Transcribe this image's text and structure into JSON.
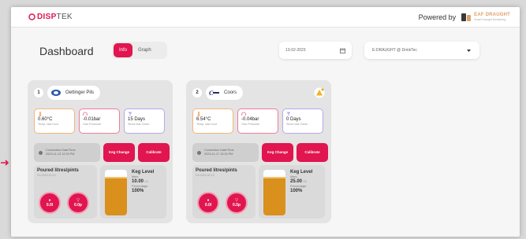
{
  "app": {
    "logo_main": "DISP",
    "logo_rest": "TEK",
    "powered_by": "Powered by",
    "brand_name_1": "EAF DRAUGHT",
    "brand_sub": "Smart Draught Monitoring"
  },
  "dashboard": {
    "title": "Dashboard",
    "tab_info": "Info",
    "tab_graph": "Graph",
    "date": "13-02-2023",
    "selector": "E-DRAUGHT @ DrinkTec"
  },
  "cards": [
    {
      "index": "1",
      "product": "Oettinger Pils",
      "temp_value": "0.60°C",
      "temp_label": "Temp. last hour",
      "pressure_value": "-0.01bar",
      "pressure_label": "Gas Pressure",
      "days_value": "15 Days",
      "days_label": "Since last Clean",
      "conn_label": "Connection Date/Time",
      "conn_value": "2023-11-13 12:00 PM",
      "keg_change": "Keg Change",
      "calibrate": "Calibrate",
      "poured_title": "Poured litres/pints",
      "poured_sub": "On 2023-02-13",
      "litres": "0.0l",
      "pints": "0.0p",
      "keg_level_title": "Keg Level",
      "keg_litres_label": "litres",
      "keg_litres_value": "10.00",
      "keg_litres_unit": "/10",
      "keg_pct_label": "Percentage",
      "keg_pct_value": "100%",
      "keg_fill": 0.85
    },
    {
      "index": "2",
      "product": "Coors",
      "temp_value": "6.54°C",
      "temp_label": "Temp. last hour",
      "pressure_value": "-0.04bar",
      "pressure_label": "Gas Pressure",
      "days_value": "0 Days",
      "days_label": "Since last Clean",
      "conn_label": "Connection Date/Time",
      "conn_value": "2023-11-17 12:00 PM",
      "keg_change": "Keg Change",
      "calibrate": "Calibrate",
      "poured_title": "Poured litres/pints",
      "poured_sub": "On 2023-02-13",
      "litres": "0.0l",
      "pints": "0.0p",
      "keg_level_title": "Keg Level",
      "keg_litres_label": "litres",
      "keg_litres_value": "25.00",
      "keg_litres_unit": "/25",
      "keg_pct_label": "Percentage",
      "keg_pct_value": "100%",
      "keg_fill": 0.85
    }
  ],
  "colors": {
    "accent": "#e1154f",
    "brand_orange": "#e0a16a",
    "keg_fill": "#d9901d"
  }
}
